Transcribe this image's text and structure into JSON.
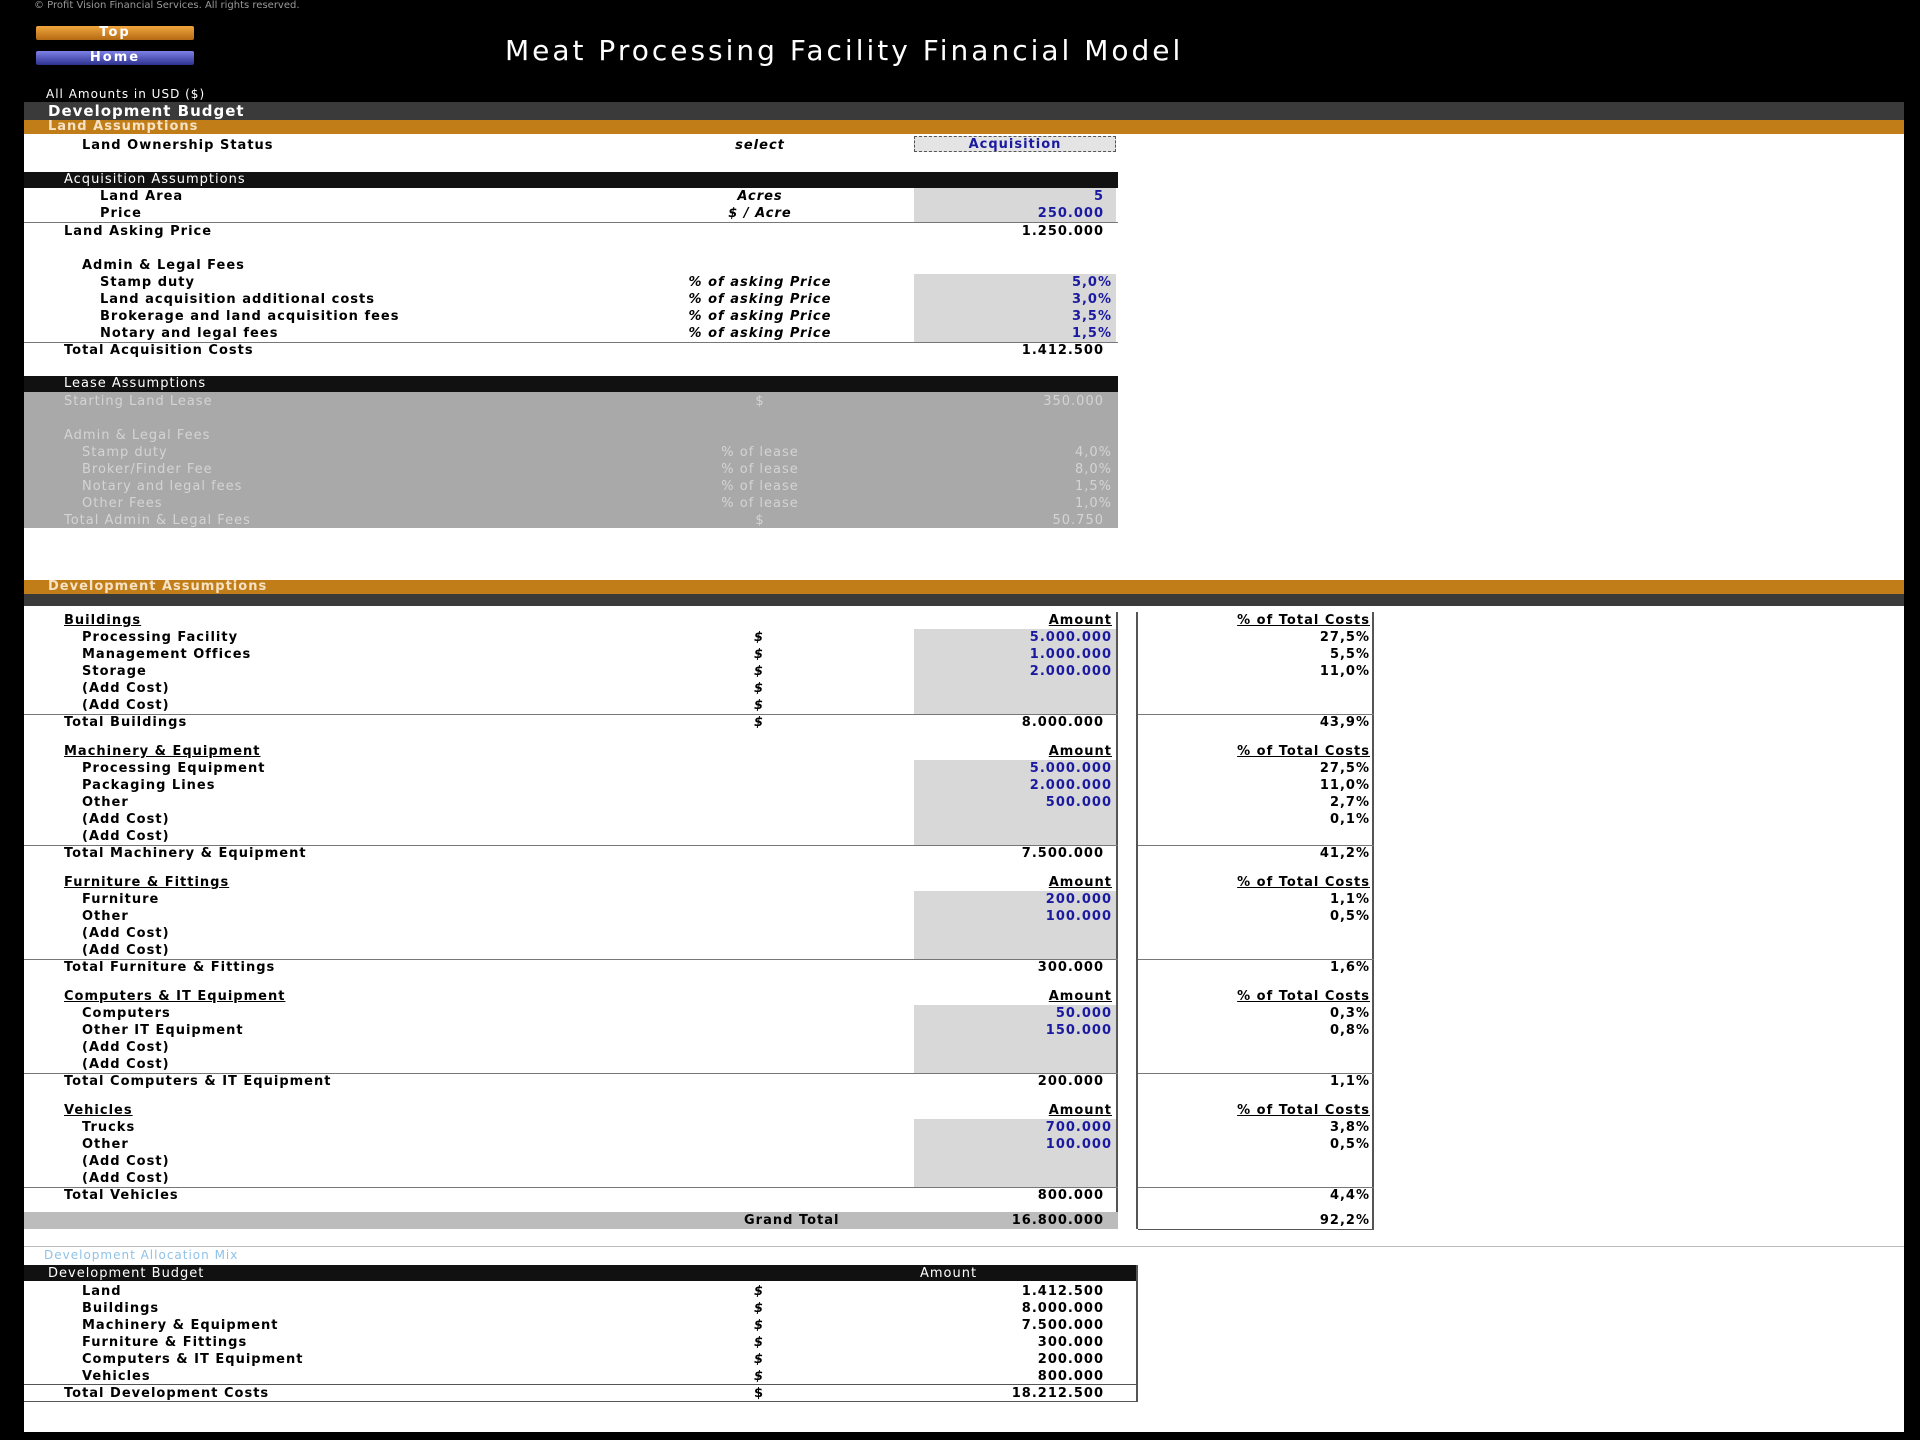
{
  "header": {
    "copyright": "© Profit Vision Financial Services. All rights reserved.",
    "top_button": "Top",
    "home_button": "Home",
    "title": "Meat Processing Facility Financial Model",
    "units_note": "All Amounts in  USD ($)"
  },
  "sections": {
    "development_budget": "Development Budget",
    "land_assumptions": "Land Assumptions",
    "development_assumptions": "Development Assumptions"
  },
  "land_ownership": {
    "label": "Land Ownership Status",
    "unit": "select",
    "value": "Acquisition"
  },
  "acquisition": {
    "header": "Acquisition Assumptions",
    "land_area": {
      "label": "Land Area",
      "unit": "Acres",
      "value": "5"
    },
    "price": {
      "label": "Price",
      "unit": "$ / Acre",
      "value": "250.000"
    },
    "asking_price": {
      "label": "Land Asking Price",
      "value": "1.250.000"
    },
    "admin_header": "Admin & Legal Fees",
    "fees": [
      {
        "label": "Stamp duty",
        "unit": "% of asking Price",
        "value": "5,0%"
      },
      {
        "label": "Land acquisition additional costs",
        "unit": "% of asking Price",
        "value": "3,0%"
      },
      {
        "label": "Brokerage and land acquisition fees",
        "unit": "% of asking Price",
        "value": "3,5%"
      },
      {
        "label": "Notary and legal fees",
        "unit": "% of asking Price",
        "value": "1,5%"
      }
    ],
    "total": {
      "label": "Total Acquisition Costs",
      "value": "1.412.500"
    }
  },
  "lease": {
    "header": "Lease Assumptions",
    "starting": {
      "label": "Starting Land Lease",
      "unit": "$",
      "value": "350.000"
    },
    "admin_header": "Admin & Legal Fees",
    "fees": [
      {
        "label": "Stamp duty",
        "unit": "% of lease",
        "value": "4,0%"
      },
      {
        "label": "Broker/Finder Fee",
        "unit": "% of lease",
        "value": "8,0%"
      },
      {
        "label": "Notary and legal fees",
        "unit": "% of lease",
        "value": "1,5%"
      },
      {
        "label": "Other Fees",
        "unit": "% of lease",
        "value": "1,0%"
      }
    ],
    "total": {
      "label": "Total Admin & Legal Fees",
      "unit": "$",
      "value": "50.750"
    }
  },
  "columns": {
    "amount": "Amount",
    "pct": "% of Total Costs"
  },
  "groups": [
    {
      "title": "Buildings",
      "items": [
        {
          "label": "Processing Facility",
          "unit": "$",
          "value": "5.000.000",
          "pct": "27,5%"
        },
        {
          "label": "Management Offices",
          "unit": "$",
          "value": "1.000.000",
          "pct": "5,5%"
        },
        {
          "label": "Storage",
          "unit": "$",
          "value": "2.000.000",
          "pct": "11,0%"
        },
        {
          "label": "(Add Cost)",
          "unit": "$",
          "value": "",
          "pct": ""
        },
        {
          "label": "(Add Cost)",
          "unit": "$",
          "value": "",
          "pct": ""
        }
      ],
      "total": {
        "label": "Total Buildings",
        "unit": "$",
        "value": "8.000.000",
        "pct": "43,9%"
      }
    },
    {
      "title": "Machinery & Equipment",
      "items": [
        {
          "label": "Processing Equipment",
          "unit": "",
          "value": "5.000.000",
          "pct": "27,5%"
        },
        {
          "label": "Packaging Lines",
          "unit": "",
          "value": "2.000.000",
          "pct": "11,0%"
        },
        {
          "label": "Other",
          "unit": "",
          "value": "500.000",
          "pct": "2,7%"
        },
        {
          "label": "(Add Cost)",
          "unit": "",
          "value": "",
          "pct": "0,1%"
        },
        {
          "label": "(Add Cost)",
          "unit": "",
          "value": "",
          "pct": ""
        }
      ],
      "total": {
        "label": "Total Machinery & Equipment",
        "unit": "",
        "value": "7.500.000",
        "pct": "41,2%"
      }
    },
    {
      "title": "Furniture & Fittings",
      "items": [
        {
          "label": "Furniture",
          "unit": "",
          "value": "200.000",
          "pct": "1,1%"
        },
        {
          "label": "Other",
          "unit": "",
          "value": "100.000",
          "pct": "0,5%"
        },
        {
          "label": "(Add Cost)",
          "unit": "",
          "value": "",
          "pct": ""
        },
        {
          "label": "(Add Cost)",
          "unit": "",
          "value": "",
          "pct": ""
        }
      ],
      "total": {
        "label": "Total Furniture & Fittings",
        "unit": "",
        "value": "300.000",
        "pct": "1,6%"
      }
    },
    {
      "title": "Computers & IT Equipment",
      "items": [
        {
          "label": "Computers",
          "unit": "",
          "value": "50.000",
          "pct": "0,3%"
        },
        {
          "label": "Other IT Equipment",
          "unit": "",
          "value": "150.000",
          "pct": "0,8%"
        },
        {
          "label": "(Add Cost)",
          "unit": "",
          "value": "",
          "pct": ""
        },
        {
          "label": "(Add Cost)",
          "unit": "",
          "value": "",
          "pct": ""
        }
      ],
      "total": {
        "label": "Total Computers & IT Equipment",
        "unit": "",
        "value": "200.000",
        "pct": "1,1%"
      }
    },
    {
      "title": "Vehicles",
      "items": [
        {
          "label": "Trucks",
          "unit": "",
          "value": "700.000",
          "pct": "3,8%"
        },
        {
          "label": "Other",
          "unit": "",
          "value": "100.000",
          "pct": "0,5%"
        },
        {
          "label": "(Add Cost)",
          "unit": "",
          "value": "",
          "pct": ""
        },
        {
          "label": "(Add Cost)",
          "unit": "",
          "value": "",
          "pct": ""
        }
      ],
      "total": {
        "label": "Total Vehicles",
        "unit": "",
        "value": "800.000",
        "pct": "4,4%"
      }
    }
  ],
  "grand_total": {
    "label": "Grand Total",
    "value": "16.800.000",
    "pct": "92,2%"
  },
  "link_text": "Development Allocation Mix",
  "summary": {
    "header": "Development Budget",
    "amount_header": "Amount",
    "rows": [
      {
        "label": "Land",
        "unit": "$",
        "value": "1.412.500"
      },
      {
        "label": "Buildings",
        "unit": "$",
        "value": "8.000.000"
      },
      {
        "label": "Machinery & Equipment",
        "unit": "$",
        "value": "7.500.000"
      },
      {
        "label": "Furniture & Fittings",
        "unit": "$",
        "value": "300.000"
      },
      {
        "label": "Computers & IT Equipment",
        "unit": "$",
        "value": "200.000"
      },
      {
        "label": "Vehicles",
        "unit": "$",
        "value": "800.000"
      }
    ],
    "total": {
      "label": "Total Development Costs",
      "unit": "$",
      "value": "18.212.500"
    }
  }
}
